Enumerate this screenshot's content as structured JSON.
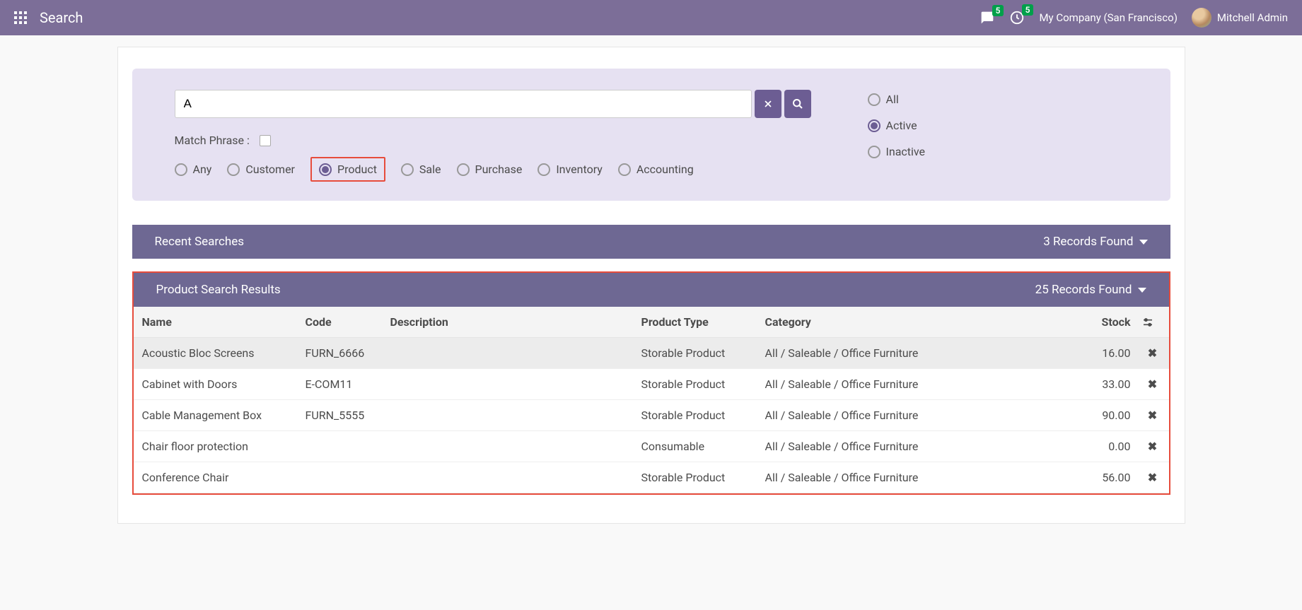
{
  "topbar": {
    "title": "Search",
    "notif_count": "5",
    "activity_count": "5",
    "company": "My Company (San Francisco)",
    "user": "Mitchell Admin"
  },
  "search": {
    "value": "A",
    "match_label": "Match Phrase :",
    "scopes": [
      "Any",
      "Customer",
      "Product",
      "Sale",
      "Purchase",
      "Inventory",
      "Accounting"
    ],
    "scope_selected": 2,
    "statuses": [
      "All",
      "Active",
      "Inactive"
    ],
    "status_selected": 1
  },
  "recent": {
    "title": "Recent Searches",
    "count_label": "3 Records Found"
  },
  "results": {
    "title": "Product Search Results",
    "count_label": "25 Records Found",
    "columns": [
      "Name",
      "Code",
      "Description",
      "Product Type",
      "Category",
      "Stock"
    ],
    "rows": [
      {
        "name": "Acoustic Bloc Screens",
        "code": "FURN_6666",
        "desc": "",
        "ptype": "Storable Product",
        "cat": "All / Saleable / Office Furniture",
        "stock": "16.00"
      },
      {
        "name": "Cabinet with Doors",
        "code": "E-COM11",
        "desc": "",
        "ptype": "Storable Product",
        "cat": "All / Saleable / Office Furniture",
        "stock": "33.00"
      },
      {
        "name": "Cable Management Box",
        "code": "FURN_5555",
        "desc": "",
        "ptype": "Storable Product",
        "cat": "All / Saleable / Office Furniture",
        "stock": "90.00"
      },
      {
        "name": "Chair floor protection",
        "code": "",
        "desc": "",
        "ptype": "Consumable",
        "cat": "All / Saleable / Office Furniture",
        "stock": "0.00"
      },
      {
        "name": "Conference Chair",
        "code": "",
        "desc": "",
        "ptype": "Storable Product",
        "cat": "All / Saleable / Office Furniture",
        "stock": "56.00"
      }
    ]
  }
}
